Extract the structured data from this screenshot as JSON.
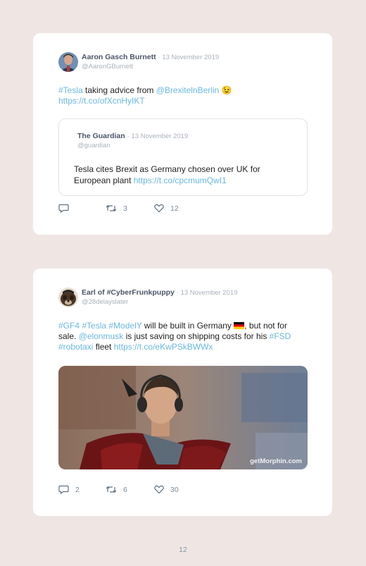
{
  "tweets": [
    {
      "author": "Aaron Gasch Burnett",
      "date": "· 13 November 2019",
      "handle": "@AaronGBurnett",
      "text": {
        "hashtag": "#Tesla",
        "part1": " taking advice from ",
        "mention": "@BrexitelnBerlin",
        "emoji": "😉",
        "link": "https://t.co/ofXcnHyIKT"
      },
      "quote": {
        "author": "The Guardian",
        "date": "· 13 November 2019",
        "handle": "@guardian",
        "text": "Tesla cites Brexit as Germany chosen over UK for European plant ",
        "link": "https://t.co/cpcmumQwI1"
      },
      "actions": {
        "replies": "",
        "retweets": "3",
        "likes": "12"
      }
    },
    {
      "author": "Earl of #CyberFrunkpuppy",
      "date": "· 13 November 2019",
      "handle": "@28delayslater",
      "text": {
        "tag1": "#GF4",
        "tag2": "#Tesla",
        "tag3": "#ModelY",
        "part1": " will be built in Germany ",
        "part2": ", but not for sale. ",
        "mention": "@elonmusk",
        "part3": " is just saving on shipping costs for his ",
        "tag4": "#FSD",
        "tag5": "#robotaxi",
        "part4": " fleet ",
        "link": "https://t.co/eKwPSkBWWx"
      },
      "media": {
        "watermark": "getMorphin.com"
      },
      "actions": {
        "replies": "2",
        "retweets": "6",
        "likes": "30"
      }
    }
  ],
  "page_number": "12",
  "colors": {
    "background": "#efe6e4",
    "card": "#ffffff",
    "link": "#6ab7e0",
    "muted": "#a9b1bb"
  }
}
